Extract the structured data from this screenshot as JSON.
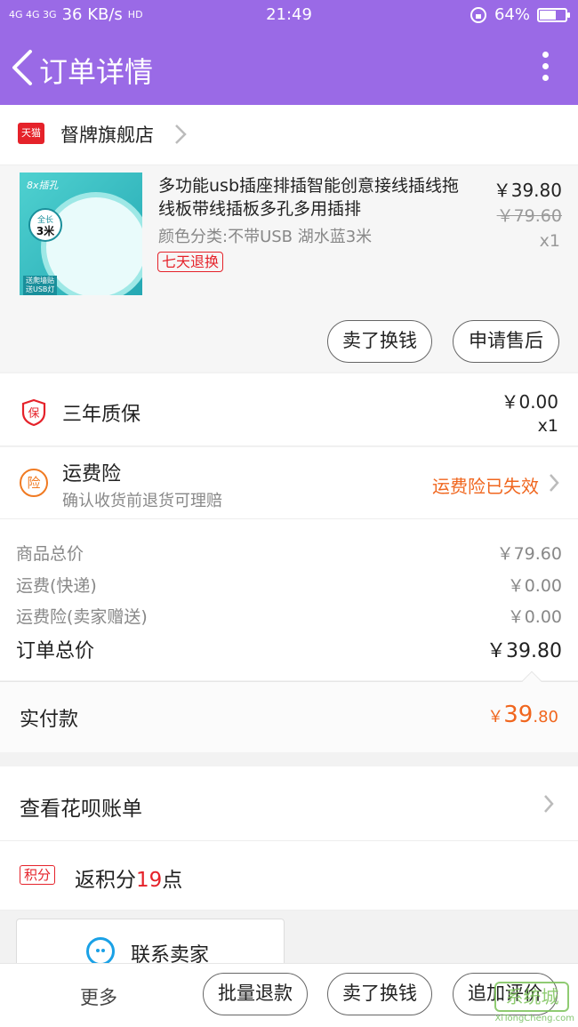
{
  "status_bar": {
    "network": "4G 4G 3G",
    "speed": "36 KB/s",
    "hd": "HD",
    "time": "21:49",
    "battery_percent": "64%",
    "battery_level": 0.64
  },
  "nav": {
    "title": "订单详情"
  },
  "shop": {
    "badge": "天猫",
    "name": "督牌旗舰店"
  },
  "product": {
    "thumb_brand": "8x插孔",
    "thumb_badge_line1": "全长",
    "thumb_badge_line2": "3米",
    "thumb_promo_line1": "送爬墙贴",
    "thumb_promo_line2": "送USB灯",
    "title": "多功能usb插座排插智能创意接线插线拖线板带线插板多孔多用插排",
    "sku": "颜色分类:不带USB 湖水蓝3米",
    "tag": "七天退换",
    "price": "￥39.80",
    "original_price": "￥79.60",
    "quantity": "x1",
    "btn_sell": "卖了换钱",
    "btn_aftersale": "申请售后"
  },
  "warranty": {
    "icon_text": "保",
    "label": "三年质保",
    "price": "￥0.00",
    "quantity": "x1"
  },
  "shipping_insurance": {
    "icon_text": "险",
    "label": "运费险",
    "sub": "确认收货前退货可理赔",
    "status": "运费险已失效"
  },
  "summary": {
    "goods_label": "商品总价",
    "goods_value": "￥79.60",
    "shipping_label": "运费(快递)",
    "shipping_value": "￥0.00",
    "insurance_label": "运费险(卖家赠送)",
    "insurance_value": "￥0.00",
    "total_label": "订单总价",
    "total_value": "￥39.80"
  },
  "paid": {
    "label": "实付款",
    "currency": "￥",
    "integer": "39",
    "decimal": ".80"
  },
  "huabei": {
    "label": "查看花呗账单"
  },
  "points": {
    "tag": "积分",
    "prefix": "返积分",
    "value": "19",
    "suffix": "点"
  },
  "contact": {
    "label": "联系卖家"
  },
  "bottom_bar": {
    "more": "更多",
    "btn_refund": "批量退款",
    "btn_sell": "卖了换钱",
    "btn_review": "追加评价"
  },
  "watermark": {
    "logo_text": "系统城",
    "url": "XiTongCheng.com"
  },
  "colors": {
    "header": "#9a6ae6",
    "accent_red": "#e5222a",
    "accent_orange": "#f0661e"
  }
}
